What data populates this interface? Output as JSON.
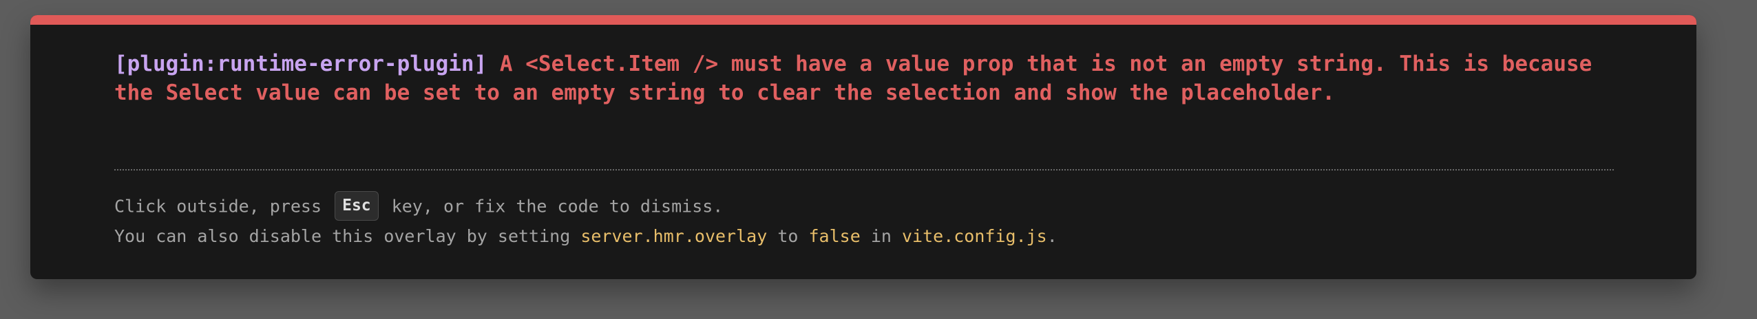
{
  "colors": {
    "backdrop": "#5d5d5d",
    "window_background": "#181818",
    "accent_bar": "#e05a58",
    "error_text": "#e06060",
    "plugin_text": "#c8a4f0",
    "tip_text": "#a4a4a4",
    "code_text": "#e8be6a"
  },
  "error": {
    "plugin": "[plugin:runtime-error-plugin]",
    "message": "A <Select.Item /> must have a value prop that is not an empty string. This is because the Select value can be set to an empty string to clear the selection and show the placeholder."
  },
  "tip": {
    "line1_prefix": "Click outside, press",
    "key": "Esc",
    "line1_suffix": "key, or fix the code to dismiss.",
    "line2_prefix": "You can also disable this overlay by setting",
    "option": "server.hmr.overlay",
    "to": "to",
    "value": "false",
    "in": "in",
    "config_file": "vite.config.js",
    "period": "."
  }
}
